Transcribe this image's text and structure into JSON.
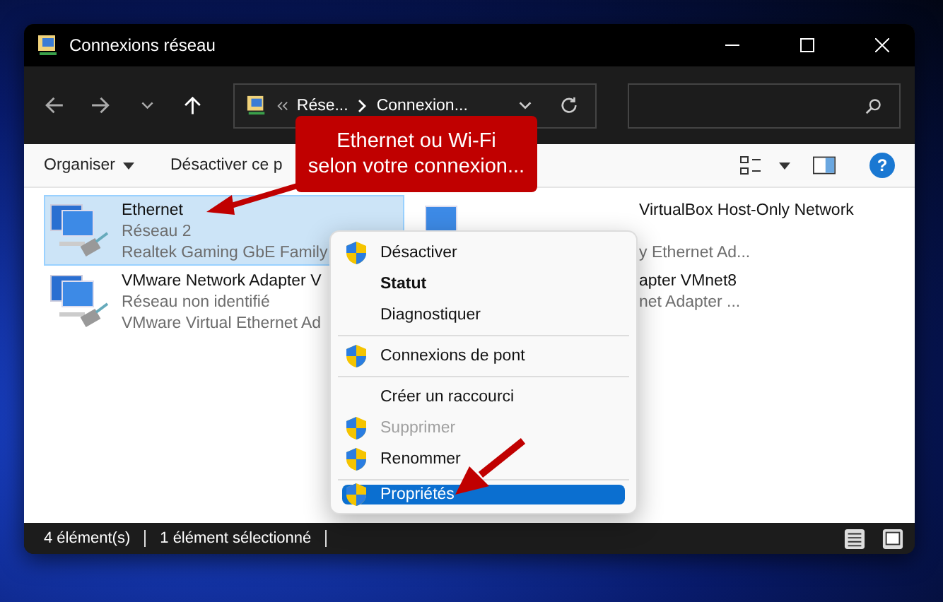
{
  "window": {
    "title": "Connexions réseau"
  },
  "address": {
    "segments": [
      "Rése...",
      "Connexion..."
    ]
  },
  "toolbar": {
    "organize": "Organiser",
    "disable": "Désactiver ce p",
    "help": "?"
  },
  "items": [
    {
      "name": "Ethernet",
      "lines": [
        "Réseau 2",
        "Realtek Gaming GbE Family"
      ],
      "selected": true,
      "cut": false
    },
    {
      "name": "VirtualBox Host-Only Network",
      "lines": [
        "y Ethernet Ad..."
      ],
      "selected": false,
      "cut": true
    },
    {
      "name": "VMware Network Adapter V",
      "lines": [
        "Réseau non identifié",
        "VMware Virtual Ethernet Ad"
      ],
      "selected": false,
      "cut": false
    },
    {
      "name": "apter VMnet8",
      "lines": [
        "net Adapter ..."
      ],
      "selected": false,
      "cut": true
    }
  ],
  "menu": {
    "groups": [
      [
        {
          "label": "Désactiver",
          "shield": true,
          "bold": false,
          "disabled": false,
          "selected": false
        },
        {
          "label": "Statut",
          "shield": false,
          "bold": true,
          "disabled": false,
          "selected": false
        },
        {
          "label": "Diagnostiquer",
          "shield": false,
          "bold": false,
          "disabled": false,
          "selected": false
        }
      ],
      [
        {
          "label": "Connexions de pont",
          "shield": true,
          "bold": false,
          "disabled": false,
          "selected": false
        }
      ],
      [
        {
          "label": "Créer un raccourci",
          "shield": false,
          "bold": false,
          "disabled": false,
          "selected": false
        },
        {
          "label": "Supprimer",
          "shield": true,
          "bold": false,
          "disabled": true,
          "selected": false
        },
        {
          "label": "Renommer",
          "shield": true,
          "bold": false,
          "disabled": false,
          "selected": false
        }
      ],
      [
        {
          "label": "Propriétés",
          "shield": true,
          "bold": false,
          "disabled": false,
          "selected": true
        }
      ]
    ]
  },
  "callout": {
    "lines": [
      "Ethernet ou Wi-Fi",
      "selon votre connexion..."
    ]
  },
  "status_bar": {
    "count": "4 élément(s)",
    "selection": "1 élément sélectionné"
  }
}
